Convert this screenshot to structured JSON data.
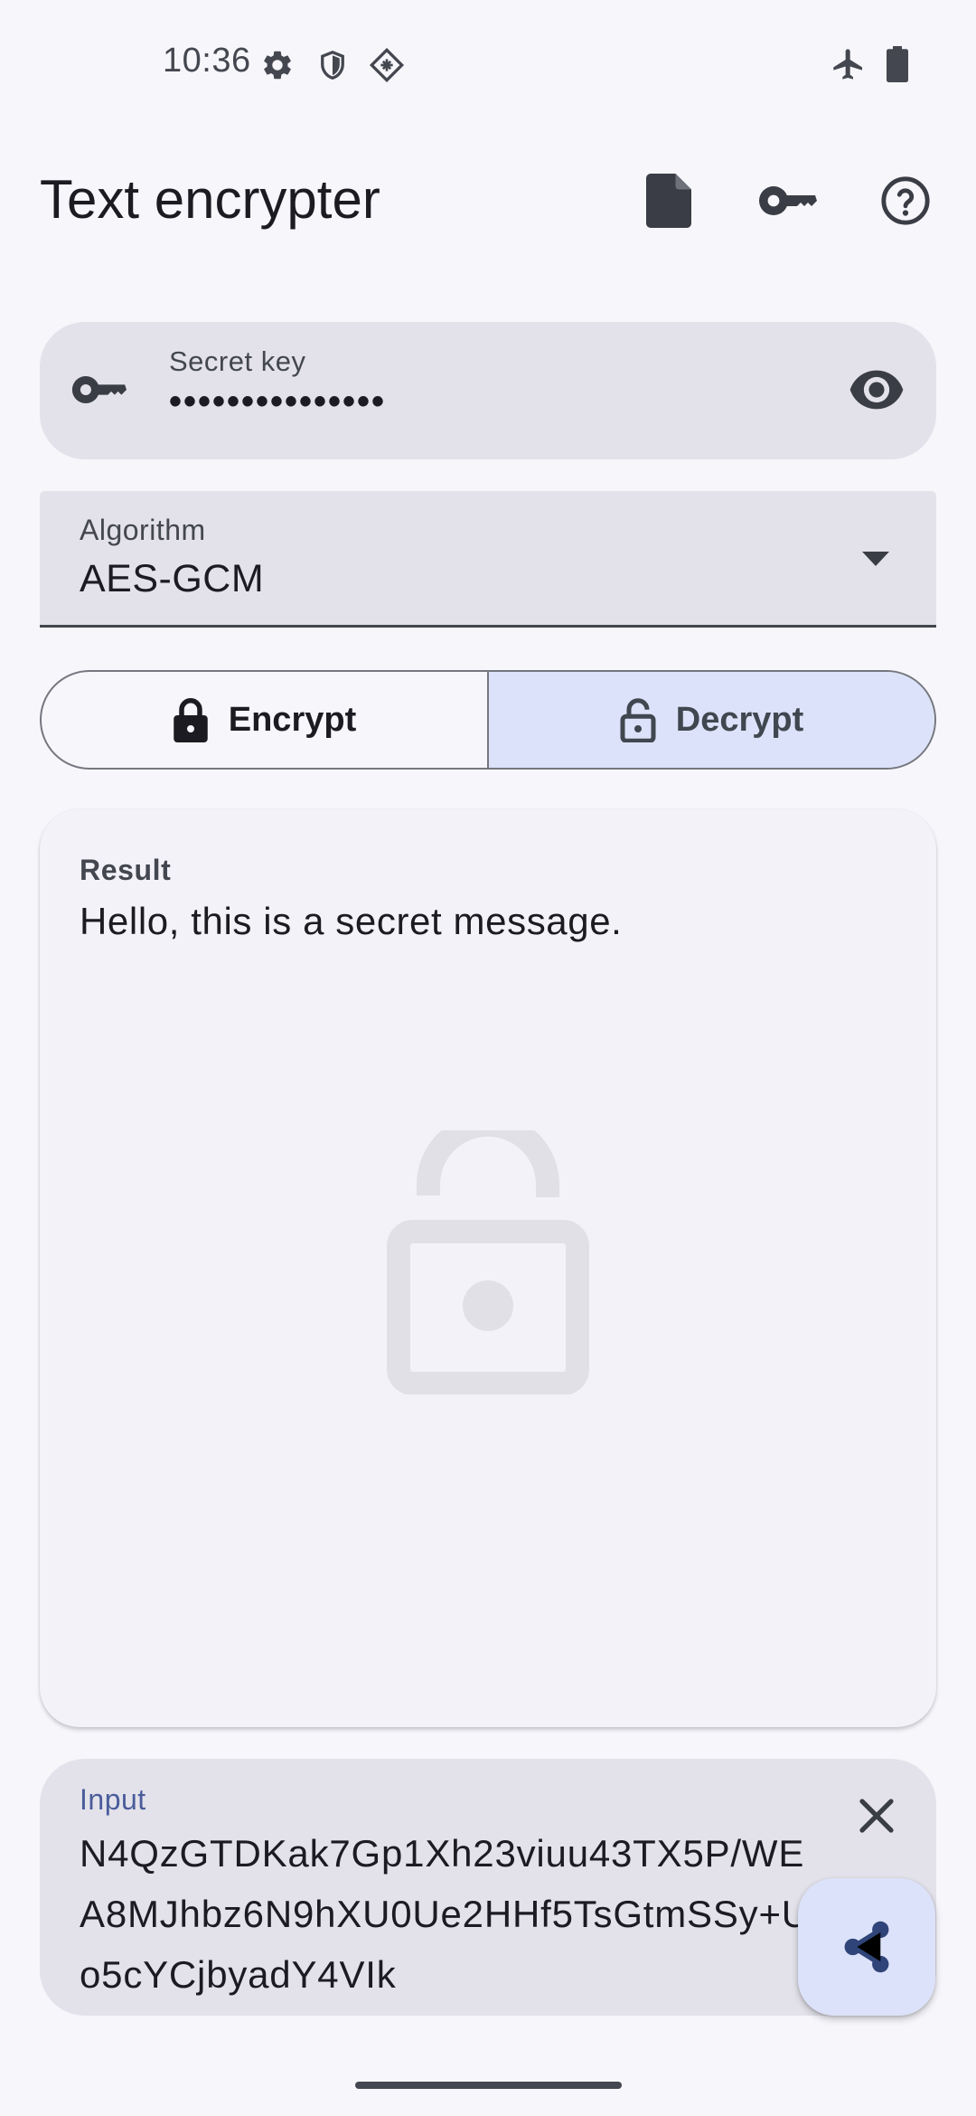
{
  "status_bar": {
    "time": "10:36",
    "icons_left": [
      "settings-icon",
      "shield-icon",
      "vpn-diamond-icon"
    ],
    "icons_right": [
      "airplane-mode-icon",
      "battery-icon"
    ]
  },
  "app_bar": {
    "title": "Text encrypter",
    "actions": [
      "file-icon",
      "key-icon",
      "help-icon"
    ]
  },
  "secret_key": {
    "label": "Secret key",
    "value": "•••••••••••••••",
    "leading_icon": "key-icon",
    "trailing_icon": "visibility-icon"
  },
  "algorithm": {
    "label": "Algorithm",
    "selected": "AES-GCM"
  },
  "mode": {
    "encrypt_label": "Encrypt",
    "decrypt_label": "Decrypt",
    "selected": "Decrypt"
  },
  "result": {
    "label": "Result",
    "text": "Hello, this is a secret message."
  },
  "input": {
    "label": "Input",
    "value": "N4QzGTDKak7Gp1Xh23viuu43TX5P/WEA8MJhbz6N9hXU0Ue2HHf5TsGtmSSy+Uo5cYCjbyadY4VIk"
  },
  "colors": {
    "background": "#f7f6fb",
    "field": "#e3e2ea",
    "accent_container": "#dce2f9",
    "input_label": "#4a5c9b"
  }
}
